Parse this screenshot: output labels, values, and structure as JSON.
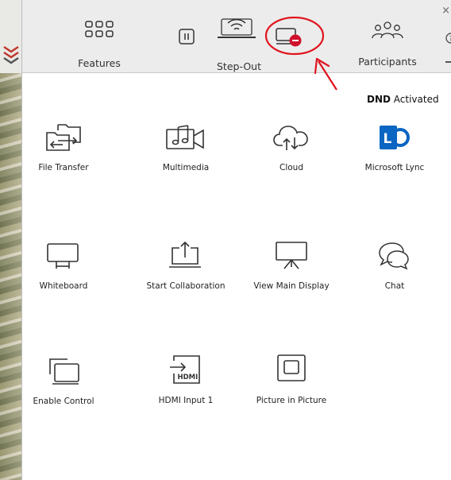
{
  "toolbar": {
    "features_label": "Features",
    "stepout_label": "Step-Out",
    "participants_label": "Participants",
    "close_glyph": "×"
  },
  "annotation": {
    "bold": "DND",
    "text": " Activated",
    "color": "#e0141e"
  },
  "features": [
    {
      "label": "File Transfer",
      "icon": "file-transfer-icon"
    },
    {
      "label": "Multimedia",
      "icon": "multimedia-icon"
    },
    {
      "label": "Cloud",
      "icon": "cloud-icon"
    },
    {
      "label": "Microsoft Lync",
      "icon": "microsoft-lync-icon"
    },
    {
      "label": "Whiteboard",
      "icon": "whiteboard-icon"
    },
    {
      "label": "Start Collaboration",
      "icon": "start-collaboration-icon"
    },
    {
      "label": "View Main Display",
      "icon": "view-main-display-icon"
    },
    {
      "label": "Chat",
      "icon": "chat-icon"
    },
    {
      "label": "Enable Control",
      "icon": "enable-control-icon"
    },
    {
      "label": "HDMI Input 1",
      "icon": "hdmi-input-icon"
    },
    {
      "label": "Picture in Picture",
      "icon": "picture-in-picture-icon"
    }
  ],
  "hdmi_badge": "HDMI",
  "colors": {
    "toolbar_bg": "#ececec",
    "lync_blue": "#0b65c2",
    "dnd_red": "#d0102a",
    "icon_stroke": "#333333"
  }
}
